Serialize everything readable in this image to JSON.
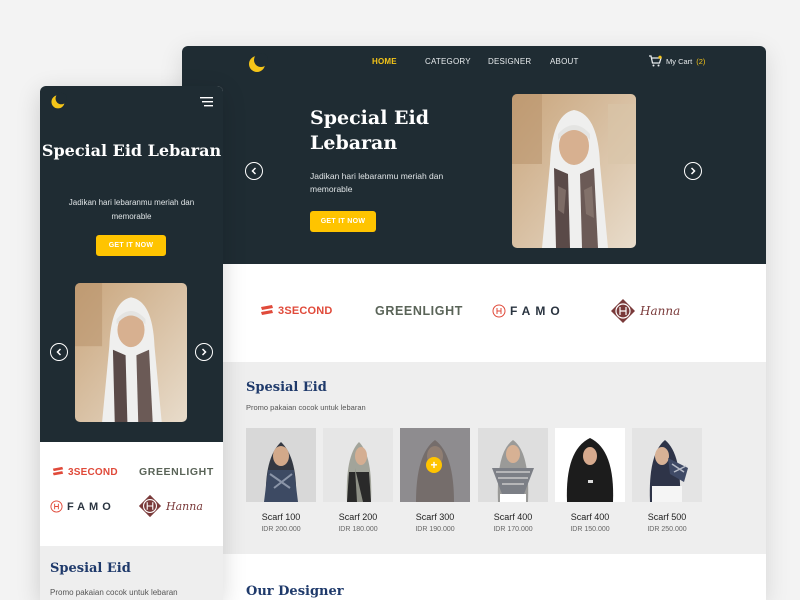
{
  "desktop": {
    "nav": {
      "items": [
        {
          "label": "HOME",
          "active": true
        },
        {
          "label": "CATEGORY",
          "active": false
        },
        {
          "label": "DESIGNER",
          "active": false
        },
        {
          "label": "ABOUT",
          "active": false
        }
      ],
      "cart_label": "My Cart",
      "cart_count": "(2)"
    },
    "hero": {
      "title": "Special Eid Lebaran",
      "subtitle": "Jadikan hari lebaranmu meriah dan memorable",
      "cta": "GET IT NOW"
    },
    "brands": [
      "3SECOND",
      "GREENLIGHT",
      "FAMO",
      "Hanna"
    ],
    "spesial": {
      "title": "Spesial Eid",
      "subtitle": "Promo pakaian cocok untuk lebaran",
      "products": [
        {
          "name": "Scarf 100",
          "price": "IDR 200.000"
        },
        {
          "name": "Scarf 200",
          "price": "IDR 180.000"
        },
        {
          "name": "Scarf 300",
          "price": "IDR 190.000"
        },
        {
          "name": "Scarf 400",
          "price": "IDR 170.000"
        },
        {
          "name": "Scarf 400",
          "price": "IDR 150.000"
        },
        {
          "name": "Scarf 500",
          "price": "IDR 250.000"
        }
      ]
    },
    "designer": {
      "title": "Our Designer"
    }
  },
  "mobile": {
    "hero": {
      "title": "Special Eid Lebaran",
      "subtitle": "Jadikan hari lebaranmu meriah dan memorable",
      "cta": "GET IT NOW"
    },
    "brands": [
      "3SECOND",
      "GREENLIGHT",
      "FAMO",
      "Hanna"
    ],
    "spesial": {
      "title": "Spesial Eid",
      "subtitle": "Promo pakaian cocok untuk lebaran"
    }
  },
  "colors": {
    "hero_bg": "#1f2c33",
    "accent": "#ffc400",
    "heading": "#1f3a6b",
    "brand_3second": "#e04a3a",
    "brand_hanna": "#7a3a3a"
  },
  "icons": [
    "moon-logo-icon",
    "cart-icon",
    "arrow-left-icon",
    "arrow-right-icon",
    "hamburger-menu-icon",
    "plus-icon"
  ]
}
